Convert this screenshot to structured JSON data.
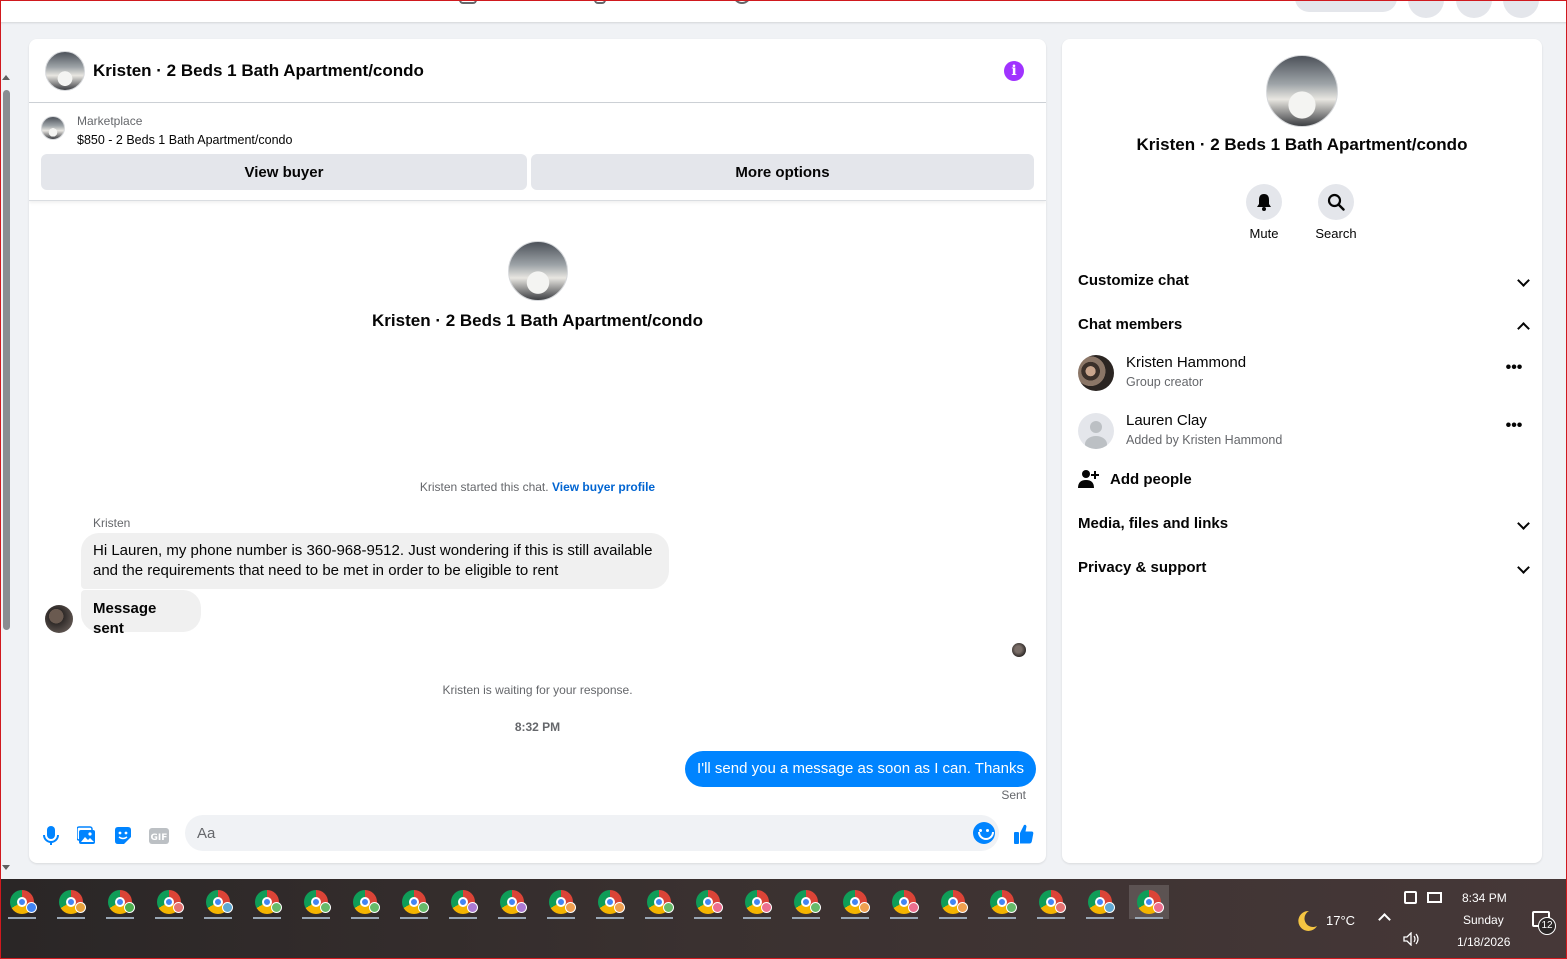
{
  "chat": {
    "title": "Kristen · 2 Beds 1 Bath Apartment/condo",
    "marketplace_label": "Marketplace",
    "listing": "$850 - 2 Beds 1 Bath Apartment/condo",
    "view_buyer": "View buyer",
    "more_options": "More options",
    "intro_title": "Kristen · 2 Beds 1 Bath Apartment/condo",
    "started_text": "Kristen started this chat.",
    "view_buyer_profile": "View buyer profile",
    "sender_name": "Kristen",
    "message_1": "Hi Lauren, my phone number is 360-968-9512. Just wondering if this is still available and the requirements that need to be met in order to be eligible to rent",
    "message_2": "Message sent",
    "waiting_text": "Kristen is waiting for your response.",
    "timestamp": "8:32 PM",
    "outgoing_message": "I'll send you a message as soon as I can. Thanks",
    "sent_label": "Sent",
    "input_placeholder": "Aa"
  },
  "details": {
    "title": "Kristen · 2 Beds 1 Bath Apartment/condo",
    "mute_label": "Mute",
    "search_label": "Search",
    "customize_chat": "Customize chat",
    "chat_members": "Chat members",
    "members": [
      {
        "name": "Kristen Hammond",
        "sub": "Group creator",
        "more": "•••"
      },
      {
        "name": "Lauren Clay",
        "sub": "Added by Kristen Hammond",
        "more": "•••"
      }
    ],
    "add_people": "Add people",
    "media_files_links": "Media, files and links",
    "privacy_support": "Privacy & support"
  },
  "taskbar": {
    "temperature": "17°C",
    "time": "8:34 PM",
    "day": "Sunday",
    "date": "1/18/2026",
    "notification_count": "12",
    "app_badge_colors": [
      "#4285f4",
      "#e8a33d",
      "#4caf50",
      "#e57373",
      "#5fa8d3",
      "#66bb6a",
      "#66bb6a",
      "#66bb6a",
      "#66bb6a",
      "#ab7ad3",
      "#ab7ad3",
      "#f0a050",
      "#f0a050",
      "#66bb6a",
      "#ec6f8f",
      "#ec6f8f",
      "#66bb6a",
      "#f0a050",
      "#ec6f8f",
      "#f0a050",
      "#66bb6a",
      "#e57373",
      "#5fa8d3",
      "#ec6f8f"
    ]
  },
  "colors": {
    "accent_blue": "#0084ff",
    "info_purple": "#a033ff",
    "link_blue": "#0064d1"
  }
}
